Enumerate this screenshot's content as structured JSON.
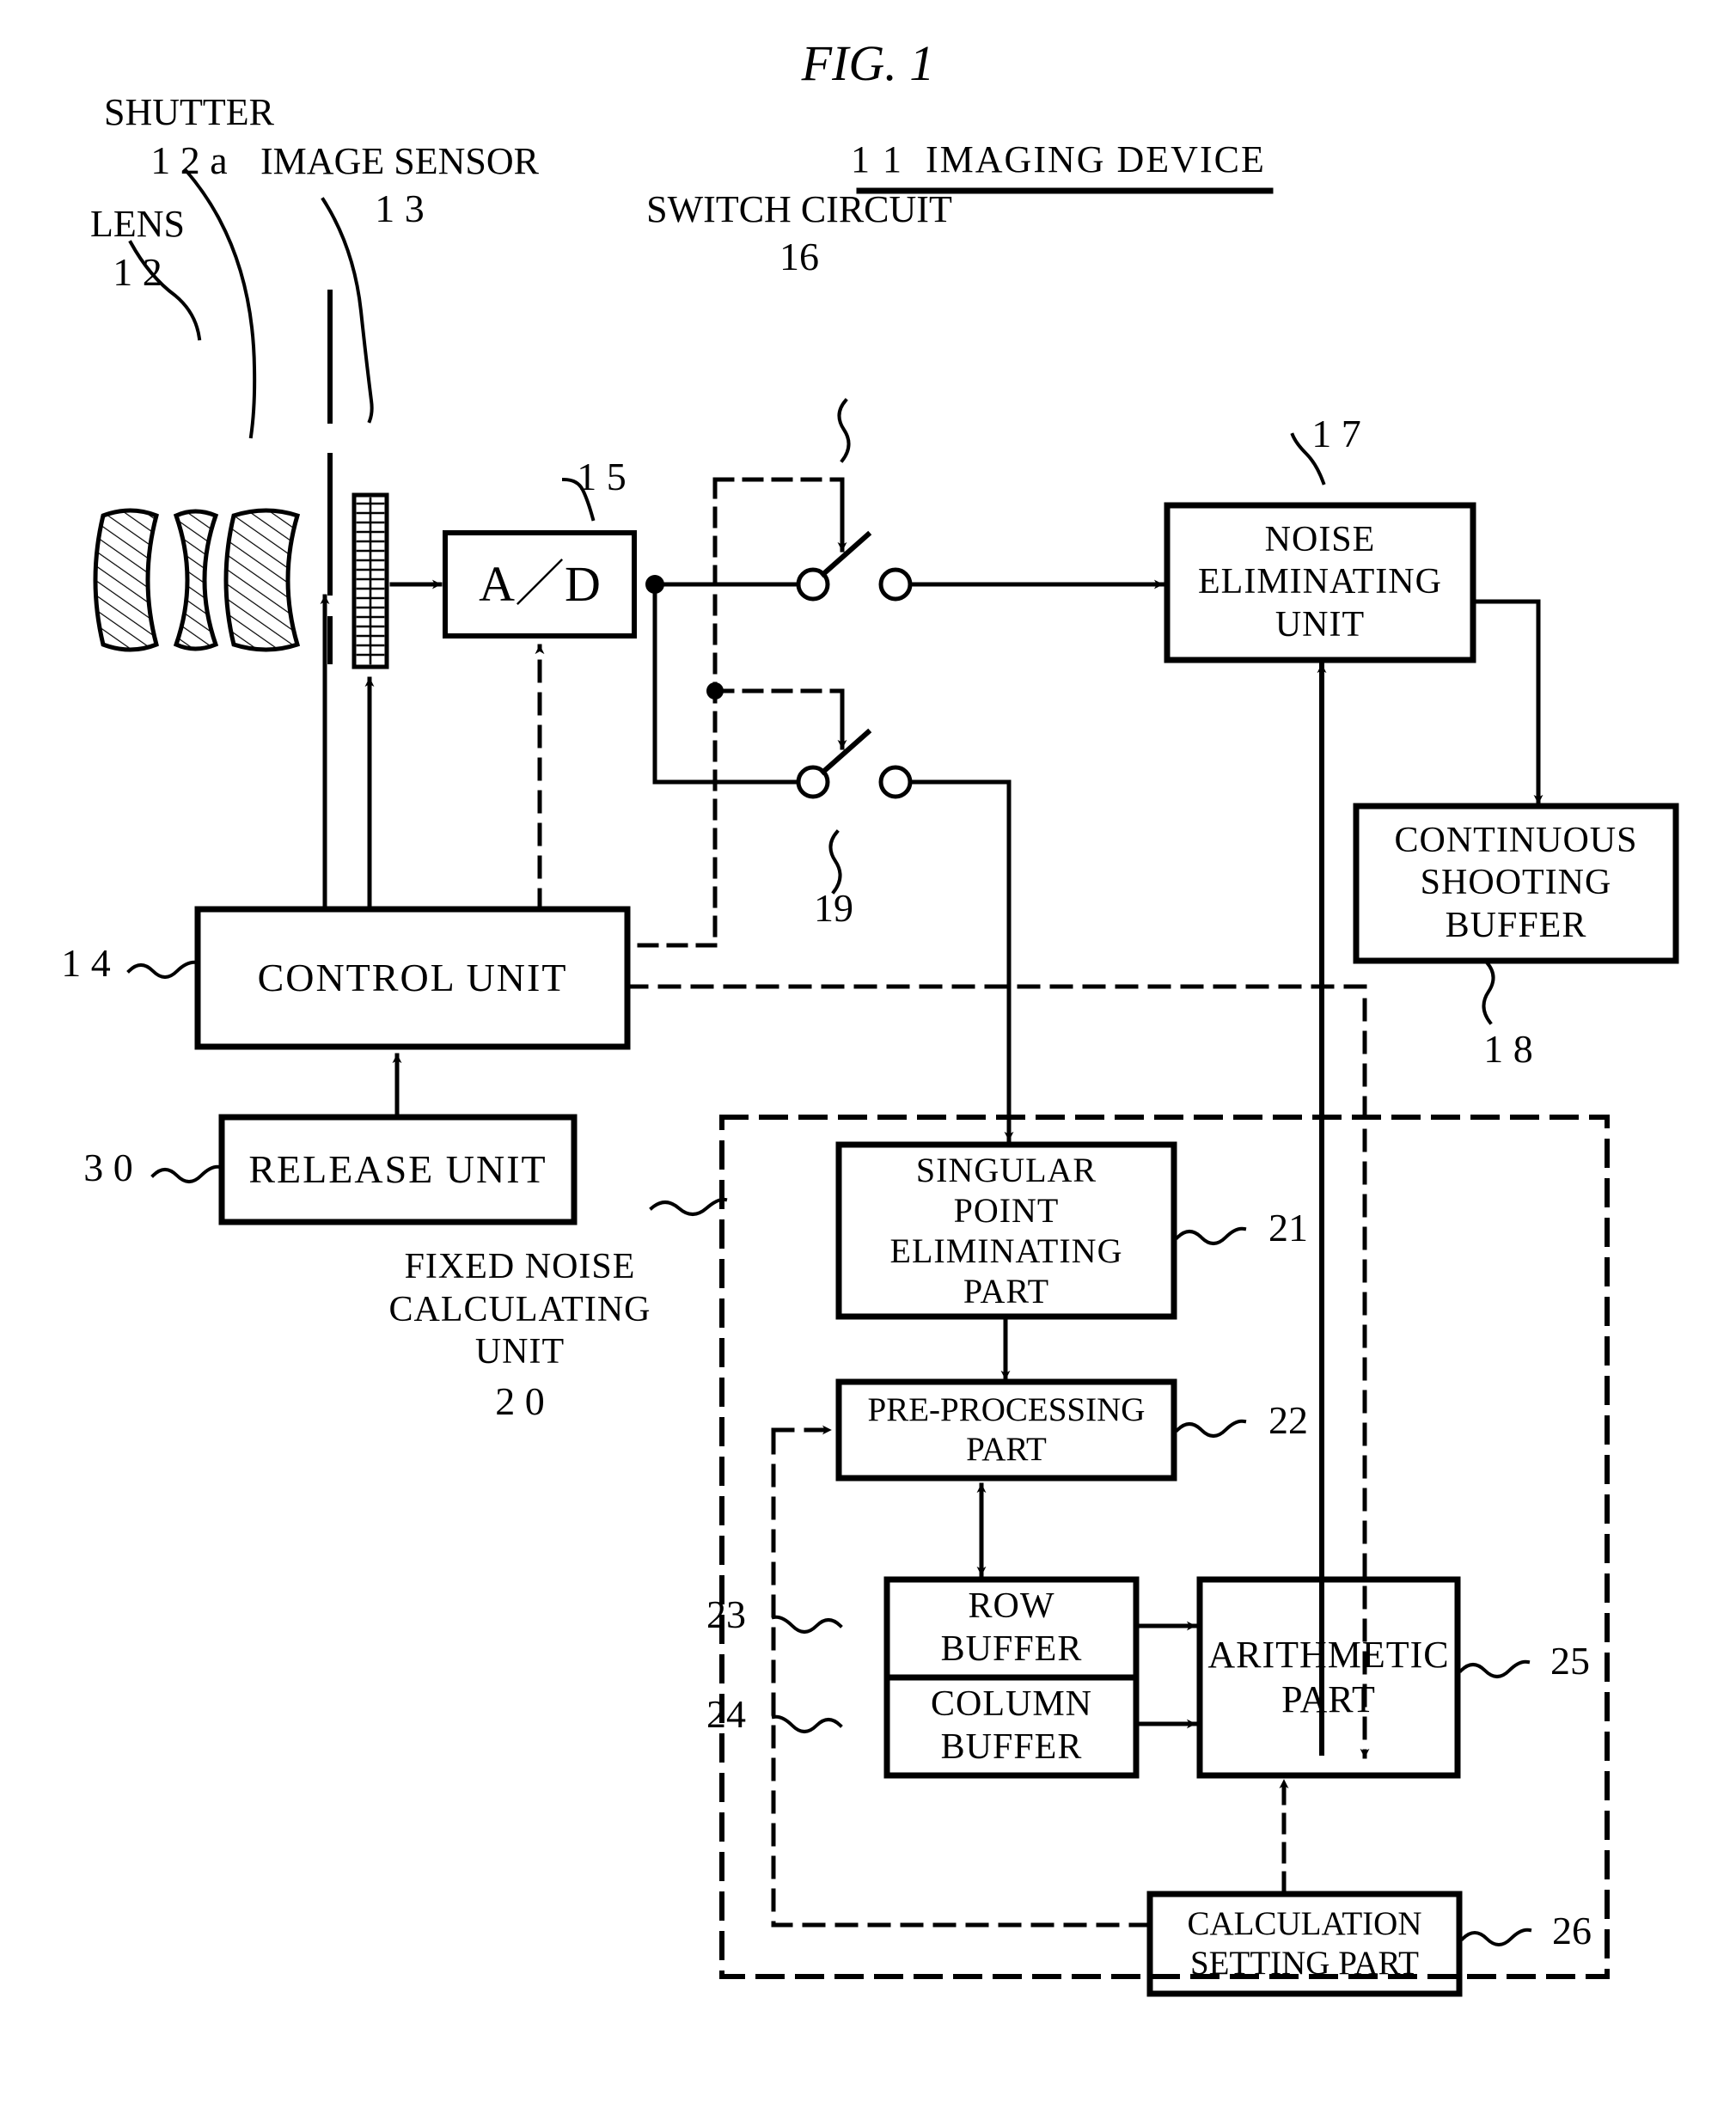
{
  "figure": {
    "title": "FIG. 1",
    "device_label": "1 1  IMAGING DEVICE"
  },
  "callouts": {
    "lens": {
      "name": "LENS",
      "number": "1 2"
    },
    "shutter": {
      "name": "SHUTTER",
      "number": "1 2 a"
    },
    "image_sensor": {
      "name": "IMAGE SENSOR",
      "number": "1 3"
    },
    "switch_circuit": {
      "name": "SWITCH CIRCUIT",
      "number": "16"
    },
    "switch_lower_number": "19",
    "ad_number": "1 5",
    "control_number": "1 4",
    "release_number": "3 0",
    "noise_number": "1 7",
    "buffer_number": "1 8",
    "fixed_noise_unit": {
      "name": "FIXED NOISE\nCALCULATING\nUNIT",
      "number": "2 0"
    },
    "singular_number": "21",
    "preprocessing_number": "22",
    "row_buffer_number": "23",
    "column_buffer_number": "24",
    "arithmetic_number": "25",
    "calculation_setting_number": "26"
  },
  "blocks": {
    "ad": "A／D",
    "control_unit": "CONTROL UNIT",
    "release_unit": "RELEASE UNIT",
    "noise_eliminating_unit": "NOISE\nELIMINATING\nUNIT",
    "continuous_shooting_buffer": "CONTINUOUS\nSHOOTING\nBUFFER",
    "singular_point_eliminating_part": "SINGULAR\nPOINT\nELIMINATING\nPART",
    "pre_processing_part": "PRE-PROCESSING\nPART",
    "row_buffer": "ROW\nBUFFER",
    "column_buffer": "COLUMN\nBUFFER",
    "arithmetic_part": "ARITHMETIC\nPART",
    "calculation_setting_part": "CALCULATION\nSETTING PART"
  },
  "colors": {
    "ink": "#000000",
    "paper": "#ffffff"
  }
}
